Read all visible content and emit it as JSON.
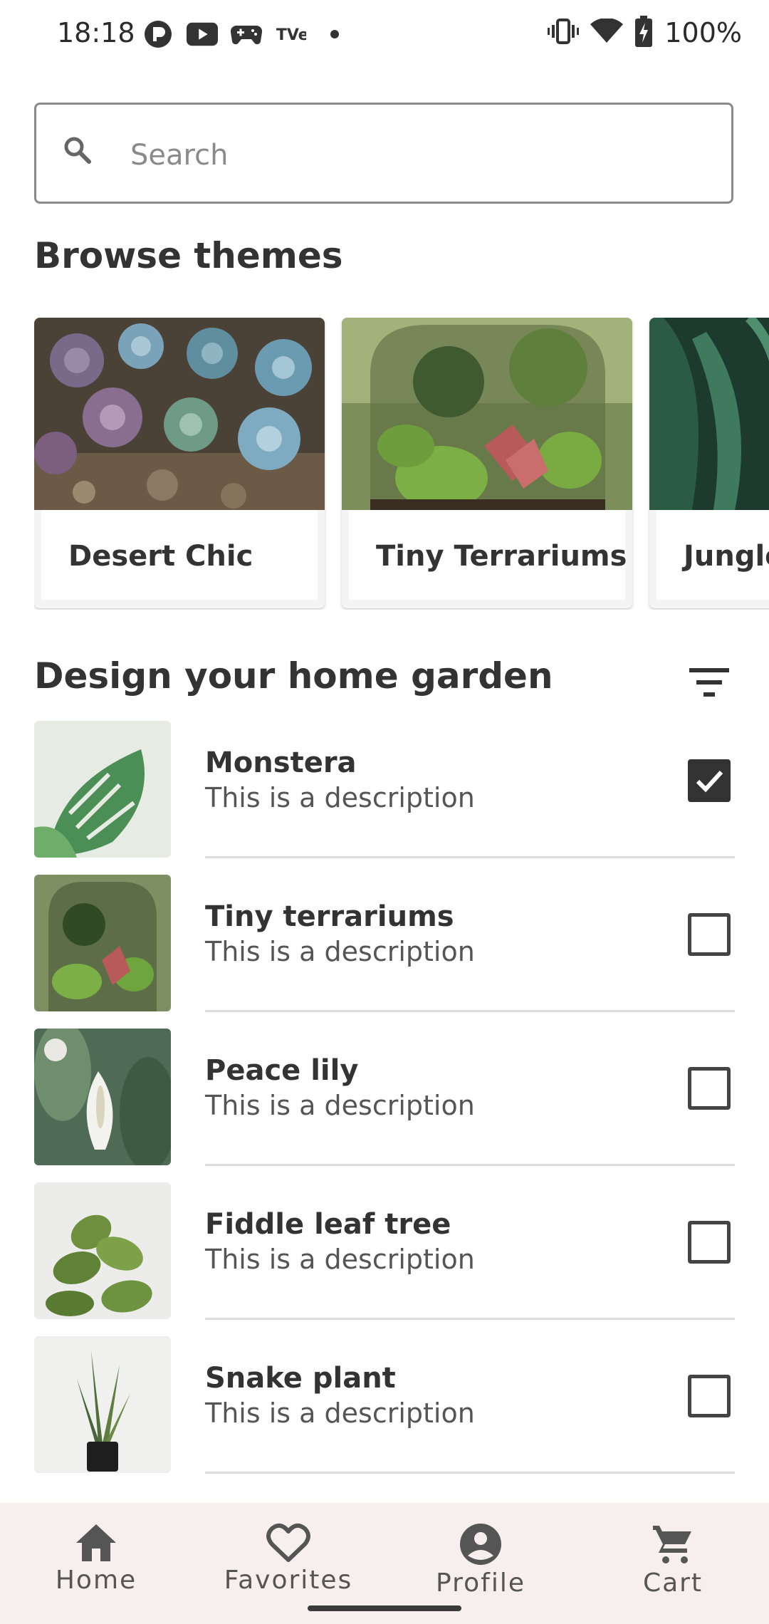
{
  "status_bar": {
    "time": "18:18",
    "left_icons": [
      "notification-p-icon",
      "youtube-icon",
      "gamepad-icon",
      "tver-icon",
      "dot-icon"
    ],
    "tver_text": "TVer",
    "battery_percent": "100%"
  },
  "search": {
    "placeholder": "Search"
  },
  "browse": {
    "title": "Browse themes",
    "themes": [
      {
        "label": "Desert Chic"
      },
      {
        "label": "Tiny Terrariums"
      },
      {
        "label": "Jungle"
      }
    ]
  },
  "garden": {
    "title": "Design your home garden",
    "items": [
      {
        "name": "Monstera",
        "description": "This is a description",
        "checked": true
      },
      {
        "name": "Tiny terrariums",
        "description": "This is a description",
        "checked": false
      },
      {
        "name": "Peace lily",
        "description": "This is a description",
        "checked": false
      },
      {
        "name": "Fiddle leaf tree",
        "description": "This is a description",
        "checked": false
      },
      {
        "name": "Snake plant",
        "description": "This is a description",
        "checked": false
      }
    ]
  },
  "nav": {
    "home": "Home",
    "favorites": "Favorites",
    "profile": "Profile",
    "cart": "Cart"
  },
  "colors": {
    "nav_bg": "#f7efed",
    "text": "#333333",
    "checkbox_checked": "#333333"
  }
}
